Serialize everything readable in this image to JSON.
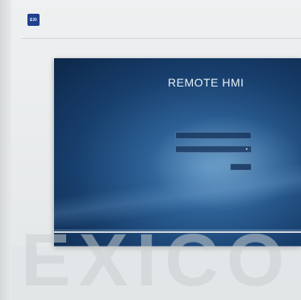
{
  "brand": {
    "logo_text": "EXI",
    "watermark_text": "EXICO",
    "accent_color": "#1f3f8f"
  },
  "hmi": {
    "title": "REMOTE HMI",
    "subtitle": "",
    "username_label": "",
    "password_label": "",
    "password_value": "",
    "login_label": "",
    "link_text": "",
    "footer_text": ""
  },
  "icons": {
    "select_arrow": "chevron-down-icon"
  }
}
